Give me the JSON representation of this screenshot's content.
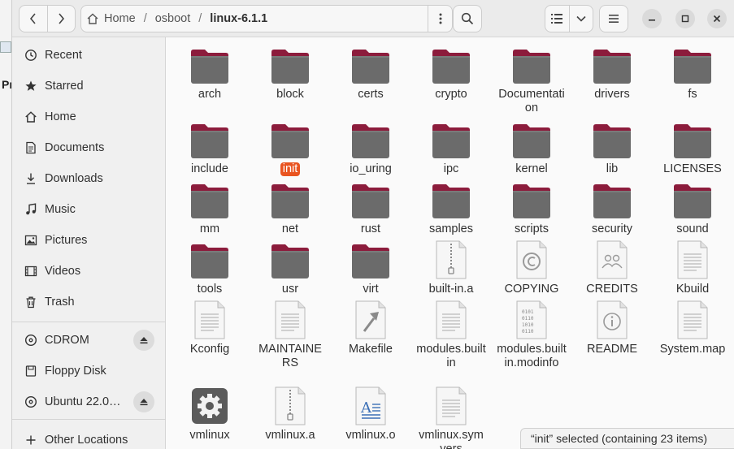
{
  "window": {
    "path": [
      "Home",
      "osboot",
      "linux-6.1.1"
    ],
    "back_icon": "chevron-left-icon",
    "forward_icon": "chevron-right-icon"
  },
  "background_window": {
    "text": "Pr"
  },
  "sidebar": {
    "places": [
      {
        "label": "Recent",
        "icon": "clock-icon"
      },
      {
        "label": "Starred",
        "icon": "star-icon"
      },
      {
        "label": "Home",
        "icon": "home-icon"
      },
      {
        "label": "Documents",
        "icon": "document-icon"
      },
      {
        "label": "Downloads",
        "icon": "download-icon"
      },
      {
        "label": "Music",
        "icon": "music-icon"
      },
      {
        "label": "Pictures",
        "icon": "picture-icon"
      },
      {
        "label": "Videos",
        "icon": "video-icon"
      },
      {
        "label": "Trash",
        "icon": "trash-icon"
      }
    ],
    "devices": [
      {
        "label": "CDROM",
        "icon": "disc-icon",
        "eject": true
      },
      {
        "label": "Floppy Disk",
        "icon": "drive-icon",
        "eject": false
      },
      {
        "label": "Ubuntu 22.0…",
        "icon": "disc-icon",
        "eject": true
      }
    ],
    "other": {
      "label": "Other Locations",
      "icon": "plus-icon"
    }
  },
  "files": [
    {
      "name": "arch",
      "type": "folder"
    },
    {
      "name": "block",
      "type": "folder"
    },
    {
      "name": "certs",
      "type": "folder"
    },
    {
      "name": "crypto",
      "type": "folder"
    },
    {
      "name": "Documentation",
      "type": "folder"
    },
    {
      "name": "drivers",
      "type": "folder"
    },
    {
      "name": "fs",
      "type": "folder"
    },
    {
      "name": "include",
      "type": "folder"
    },
    {
      "name": "init",
      "type": "folder",
      "selected": true
    },
    {
      "name": "io_uring",
      "type": "folder"
    },
    {
      "name": "ipc",
      "type": "folder"
    },
    {
      "name": "kernel",
      "type": "folder"
    },
    {
      "name": "lib",
      "type": "folder"
    },
    {
      "name": "LICENSES",
      "type": "folder"
    },
    {
      "name": "mm",
      "type": "folder"
    },
    {
      "name": "net",
      "type": "folder"
    },
    {
      "name": "rust",
      "type": "folder"
    },
    {
      "name": "samples",
      "type": "folder"
    },
    {
      "name": "scripts",
      "type": "folder"
    },
    {
      "name": "security",
      "type": "folder"
    },
    {
      "name": "sound",
      "type": "folder"
    },
    {
      "name": "tools",
      "type": "folder"
    },
    {
      "name": "usr",
      "type": "folder"
    },
    {
      "name": "virt",
      "type": "folder"
    },
    {
      "name": "built-in.a",
      "type": "archive"
    },
    {
      "name": "COPYING",
      "type": "copyright"
    },
    {
      "name": "CREDITS",
      "type": "contacts"
    },
    {
      "name": "Kbuild",
      "type": "text"
    },
    {
      "name": "Kconfig",
      "type": "text"
    },
    {
      "name": "MAINTAINERS",
      "type": "text"
    },
    {
      "name": "Makefile",
      "type": "makefile"
    },
    {
      "name": "modules.builtin",
      "type": "text"
    },
    {
      "name": "modules.builtin.modinfo",
      "type": "binary"
    },
    {
      "name": "README",
      "type": "info"
    },
    {
      "name": "System.map",
      "type": "text"
    },
    {
      "name": "vmlinux",
      "type": "executable"
    },
    {
      "name": "vmlinux.a",
      "type": "archive"
    },
    {
      "name": "vmlinux.o",
      "type": "object"
    },
    {
      "name": "vmlinux.symvers",
      "type": "text"
    }
  ],
  "status": {
    "text": "“init” selected  (containing 23 items)"
  },
  "colors": {
    "accent": "#e95420",
    "folder_tab": "#8c1c3c",
    "folder_body": "#6b6b6b"
  }
}
